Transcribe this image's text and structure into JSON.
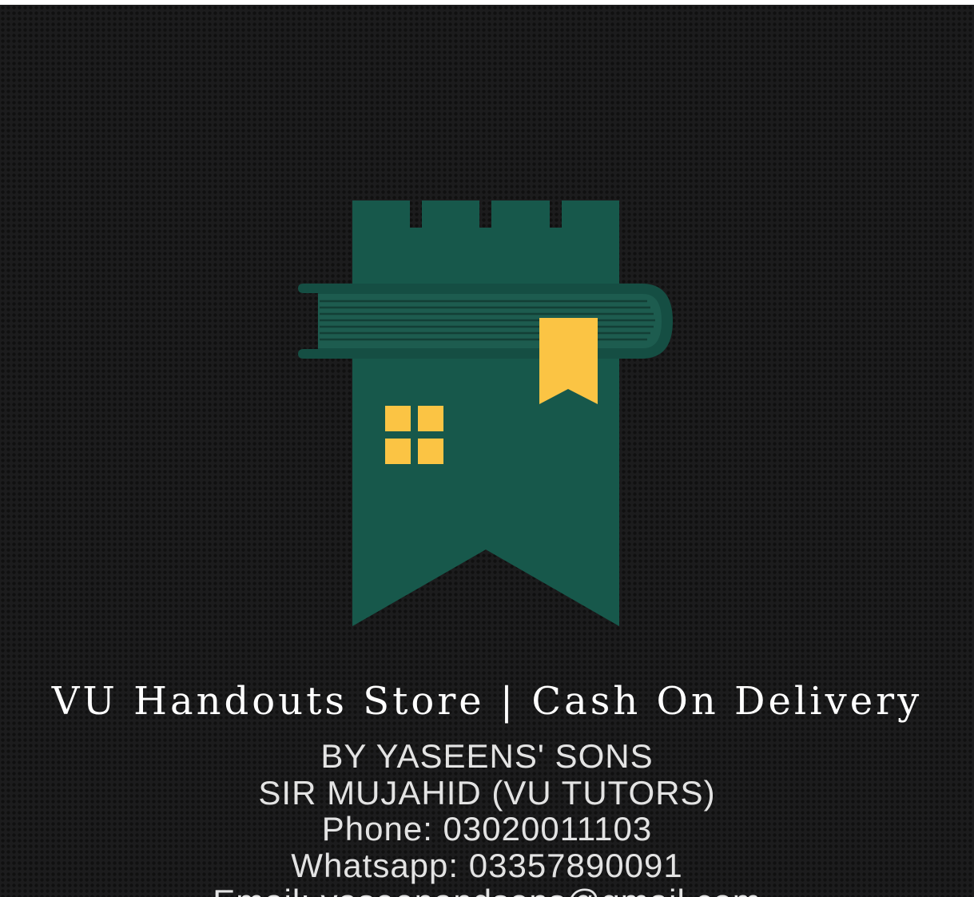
{
  "brand": {
    "logo_icon": "castle-tower-book-bookmark-icon",
    "colors": {
      "background": "#1c1c1d",
      "tower_green": "#17584b",
      "accent_yellow": "#fbc444",
      "text": "#ffffff"
    }
  },
  "store": {
    "title": "VU Handouts Store | Cash On Delivery"
  },
  "contact": {
    "by_line": "BY YASEENS' SONS",
    "tutor_line": "SIR MUJAHID (VU TUTORS)",
    "phone_line": "Phone: 03020011103",
    "whatsapp_line": "Whatsapp: 03357890091",
    "email_line": "Email: yaseenandsons@gmail.com"
  }
}
